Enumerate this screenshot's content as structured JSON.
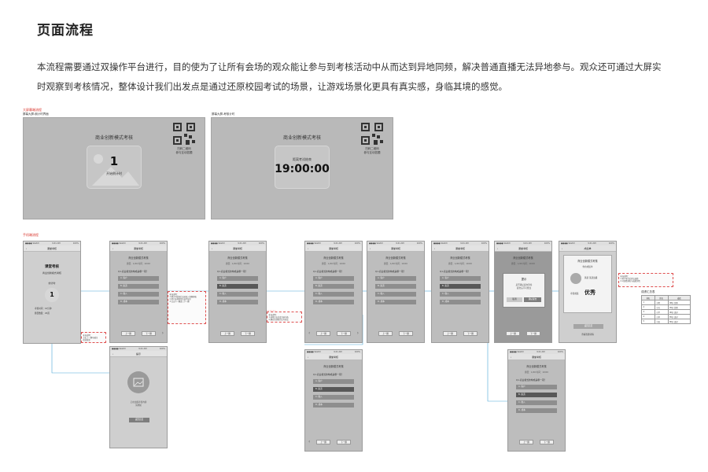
{
  "page": {
    "title": "页面流程",
    "description": "本流程需要通过双操作平台进行，目的使为了让所有会场的观众能让参与到考核活动中从而达到异地同频，解决普通直播无法异地参与。观众还可通过大屏实时观察到考核情况，整体设计我们出发点是通过还原校园考试的场景，让游戏场景化更具有真实感，身临其境的感觉。"
  },
  "flow": {
    "big_screen_caption": "大屏幕端流程",
    "big_screen_sub_a": "屏幕大屏-倒计时界面",
    "big_screen_sub_b": "屏幕大屏-考核计时",
    "mobile_caption": "手机端流程",
    "qr_label": "扫码二维码\n参与互动答题",
    "screen_a": {
      "heading": "商业创新模式考核",
      "count": "1",
      "count_label": "开始倒计时"
    },
    "screen_b": {
      "heading": "商业创新模式考核",
      "count_label": "距离考试结束",
      "countdown": "19:00:00"
    },
    "status_left": "●●●● Sketch",
    "status_time": "9:41 AM",
    "status_right": "100%",
    "nav_title": "课堂考核",
    "nav_title_result": "成绩单",
    "phone1": {
      "title": "课堂考核",
      "subtitle": "商业创新模式考核",
      "count_label": "倒计时",
      "count": "1",
      "info": [
        "考核时间：10分钟",
        "题目数量：20道"
      ]
    },
    "exam_title": "商业创新模式考核",
    "exam_meta": "题目：1/20     时间：10:00",
    "question": "Q1.商业模式的构成是哪一项？",
    "options": [
      "A. 客户",
      "B. 渠道",
      "C. 收入",
      "D. 成本"
    ],
    "btn_prev": "上一题",
    "btn_next": "下一题",
    "prompt_title": "提示",
    "prompt_text": "正在加载考核内容\n请稍候",
    "prompt_btn": "返回首页",
    "submit_modal": {
      "title": "提示",
      "text": "是否确认提交答卷\n提交后不可修改",
      "cancel": "取消",
      "confirm": "确认提交"
    },
    "result": {
      "heading": "商业创新模式考核",
      "subheading": "你的成绩单",
      "name": "黄某  某某班级",
      "grade_label": "考核成绩",
      "grade": "优秀",
      "button": "返回首页",
      "footer": "查看答题详情"
    },
    "notes": [
      "补充说明：\n点击上一题可返回\n修改答案",
      "补充说明：\n1.倒计时结束后自动进入答题界面\n2.用户选择答案后高亮显示\n3.点击下一题进入下一题",
      "补充说明：\n1.选项点击后变为选中态\n2.题目全部答完后可提交",
      "补充说明：\n1.用户答完后提交成绩\n2.可查看排名与成绩详情"
    ],
    "table": {
      "title": "成绩汇总表",
      "headers": [
        "排名",
        "姓名",
        "成绩"
      ],
      "rows": [
        [
          "1",
          "小明",
          "98分 优秀"
        ],
        [
          "2",
          "小红",
          "95分 优秀"
        ],
        [
          "3",
          "小华",
          "90分 良好"
        ],
        [
          "4",
          "小李",
          "85分 良好"
        ],
        [
          "5",
          "小张",
          "80分 良好"
        ]
      ]
    }
  },
  "colors": {
    "screen_bg": "#b9b9b9",
    "phone_bg": "#bdbdbd",
    "link_line": "#4aa7d8",
    "note_border": "#e05050"
  }
}
